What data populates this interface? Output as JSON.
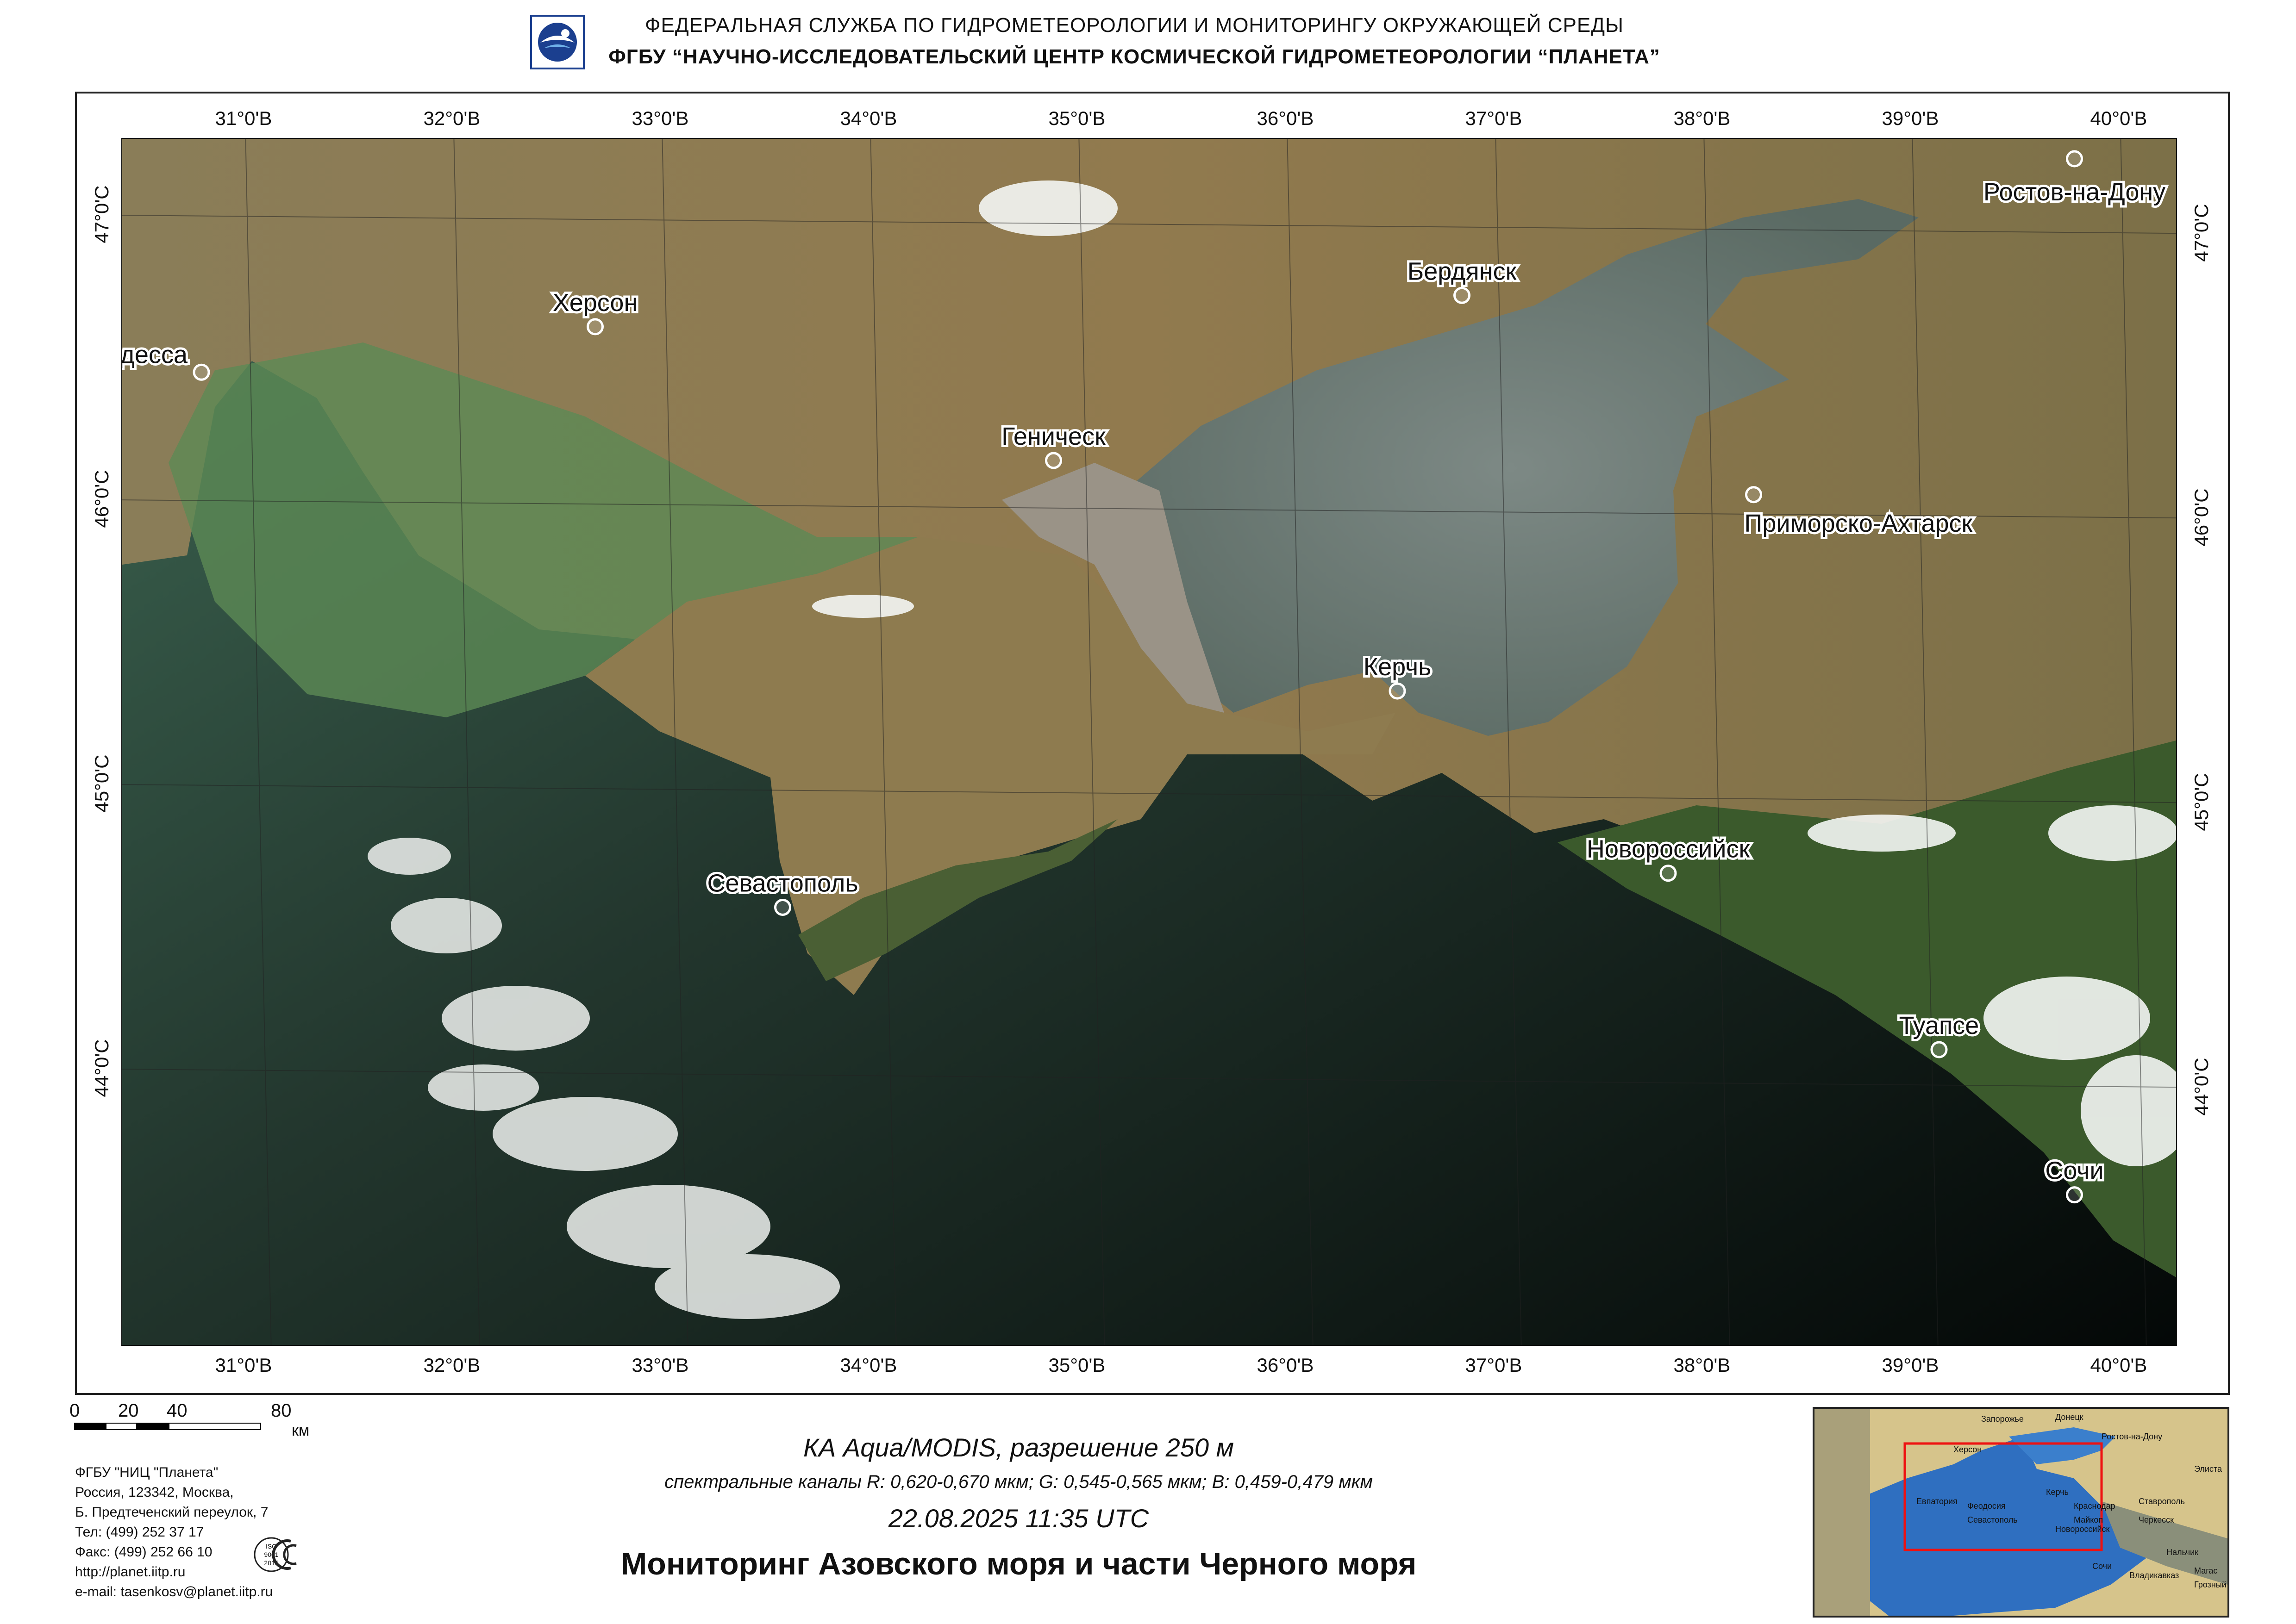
{
  "header": {
    "line1": "ФЕДЕРАЛЬНАЯ  СЛУЖБА  ПО ГИДРОМЕТЕОРОЛОГИИ И МОНИТОРИНГУ ОКРУЖАЮЩЕЙ СРЕДЫ",
    "line2": "ФГБУ “НАУЧНО-ИССЛЕДОВАТЕЛЬСКИЙ ЦЕНТР КОСМИЧЕСКОЙ ГИДРОМЕТЕОРОЛОГИИ “ПЛАНЕТА”"
  },
  "map": {
    "lon_ticks": [
      "31°0'В",
      "32°0'В",
      "33°0'В",
      "34°0'В",
      "35°0'В",
      "36°0'В",
      "37°0'В",
      "38°0'В",
      "39°0'В",
      "40°0'В"
    ],
    "lat_ticks": [
      "47°0'С",
      "46°0'С",
      "45°0'С",
      "44°0'С"
    ],
    "cities": [
      {
        "name": "Одесса",
        "lon": 30.73,
        "lat": 46.48
      },
      {
        "name": "Херсон",
        "lon": 32.62,
        "lat": 46.64
      },
      {
        "name": "Геническ",
        "lon": 34.82,
        "lat": 46.17
      },
      {
        "name": "Бердянск",
        "lon": 36.78,
        "lat": 46.75
      },
      {
        "name": "Ростов-на-Дону",
        "lon": 39.72,
        "lat": 47.23
      },
      {
        "name": "Приморско-Ахтарск",
        "lon": 38.18,
        "lat": 46.05
      },
      {
        "name": "Керчь",
        "lon": 36.47,
        "lat": 45.36
      },
      {
        "name": "Новороссийск",
        "lon": 37.77,
        "lat": 44.72
      },
      {
        "name": "Севастополь",
        "lon": 33.52,
        "lat": 44.6
      },
      {
        "name": "Туапсе",
        "lon": 39.07,
        "lat": 44.1
      },
      {
        "name": "Сочи",
        "lon": 39.72,
        "lat": 43.59
      }
    ],
    "colors": {
      "land": "#8c7a4f",
      "sea_black": "#0b1612",
      "sea_azov": "#6c7a74",
      "sea_green": "#4d7a5a",
      "cloud": "#f2f4f2",
      "forest": "#3d5a2e"
    }
  },
  "scale": {
    "labels": [
      "0",
      "20",
      "40",
      "80"
    ],
    "unit": "км"
  },
  "address": {
    "lines": [
      "ФГБУ \"НИЦ \"Планета\"",
      "Россия, 123342,  Москва,",
      "Б. Предтеченский переулок, 7",
      "Тел: (499) 252 37 17",
      "Факс: (499) 252 66 10",
      "http://planet.iitp.ru",
      "e-mail: tasenkosv@planet.iitp.ru"
    ],
    "cert_lines": [
      "ISO",
      "9001",
      "2015"
    ]
  },
  "caption": {
    "satellite": "КА Aqua/MODIS, разрешение 250 м",
    "spectral": "спектральные каналы R: 0,620-0,670 мкм; G: 0,545-0,565 мкм;  B: 0,459-0,479 мкм",
    "datetime": "22.08.2025   11:35 UTC",
    "title": "Мониторинг Азовского моря и части Черного моря"
  },
  "inset": {
    "labels": [
      "Запорожье",
      "Донецк",
      "Херсон",
      "Ростов-на-Дону",
      "Элиста",
      "Евпатория",
      "Феодосия",
      "Керчь",
      "Краснодар",
      "Ставрополь",
      "Майкоп",
      "Черкесск",
      "Новороссийск",
      "Севастополь",
      "Сочи",
      "Нальчик",
      "Владикавказ",
      "Магас",
      "Грозный"
    ]
  }
}
